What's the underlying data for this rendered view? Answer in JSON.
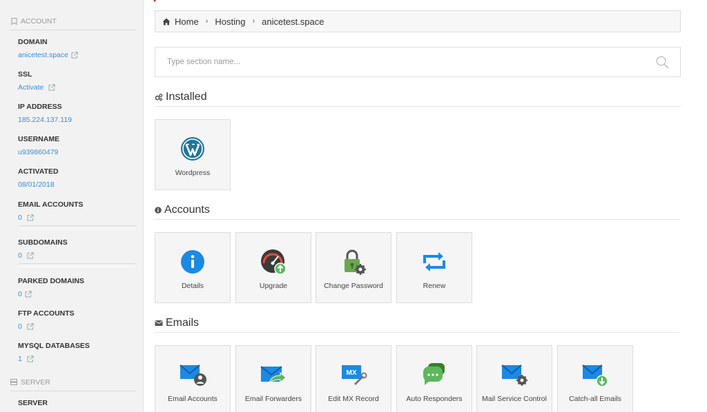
{
  "sidebar": {
    "account_header": "Account",
    "server_header": "Server",
    "items": [
      {
        "label": "Domain",
        "value": "anicetest.space"
      },
      {
        "label": "SSL",
        "value": "Activate"
      },
      {
        "label": "IP Address",
        "value": "185.224.137.119"
      },
      {
        "label": "Username",
        "value": "u939860479"
      },
      {
        "label": "Activated",
        "value": "08/01/2018"
      },
      {
        "label": "Email Accounts",
        "value": "0"
      },
      {
        "label": "Subdomains",
        "value": "0"
      },
      {
        "label": "Parked Domains",
        "value": "0"
      },
      {
        "label": "FTP Accounts",
        "value": "0"
      },
      {
        "label": "MySQL Databases",
        "value": "1"
      },
      {
        "label": "Server",
        "value": ""
      }
    ]
  },
  "breadcrumb": {
    "home": "Home",
    "hosting": "Hosting",
    "current": "anicetest.space"
  },
  "search": {
    "placeholder": "Type section name..."
  },
  "sections": {
    "installed": {
      "title": "Installed",
      "tiles": [
        "Wordpress"
      ]
    },
    "accounts": {
      "title": "Accounts",
      "tiles": [
        "Details",
        "Upgrade",
        "Change Password",
        "Renew"
      ]
    },
    "emails": {
      "title": "Emails",
      "tiles": [
        "Email Accounts",
        "Email Forwarders",
        "Edit MX Record",
        "Auto Responders",
        "Mail Service Control",
        "Catch-all Emails"
      ]
    }
  },
  "colors": {
    "link": "#3b8dd4",
    "accent_blue": "#1a8ae5",
    "accent_green": "#5cb85c",
    "sidebar_bg": "#f2f2f2"
  }
}
